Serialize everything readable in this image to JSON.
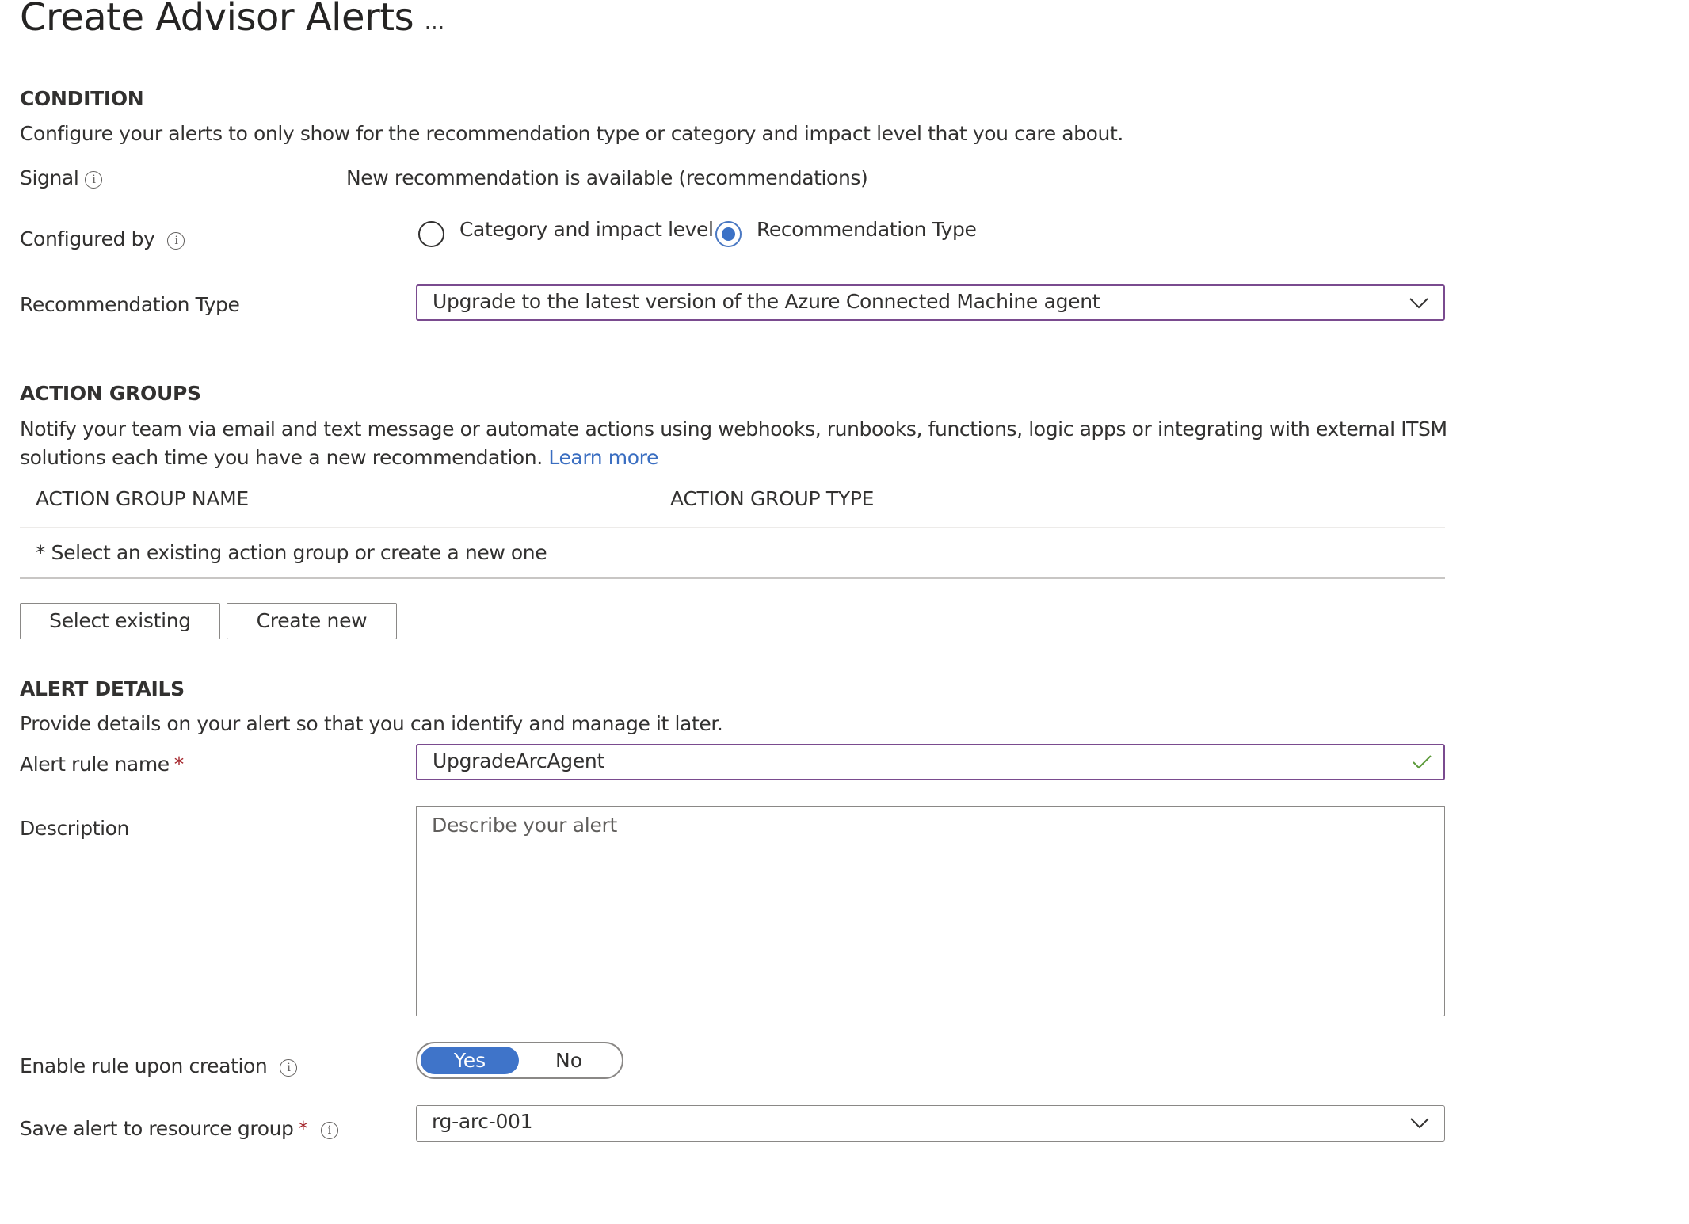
{
  "header": {
    "title": "Create Advisor Alerts",
    "more_label": "..."
  },
  "condition": {
    "heading": "CONDITION",
    "description": "Configure your alerts to only show for the recommendation type or category and impact level that you care about.",
    "signal_label": "Signal",
    "signal_value": "New recommendation is available (recommendations)",
    "configured_by_label": "Configured by",
    "configured_by_options": [
      {
        "label": "Category and impact level",
        "selected": false
      },
      {
        "label": "Recommendation Type",
        "selected": true
      }
    ],
    "recommendation_type_label": "Recommendation Type",
    "recommendation_type_value": "Upgrade to the latest version of the Azure Connected Machine agent"
  },
  "action_groups": {
    "heading": "ACTION GROUPS",
    "description_line1": "Notify your team via email and text message or automate actions using webhooks, runbooks, functions, logic apps or integrating with external ITSM",
    "description_line2": "solutions each time you have a new recommendation.",
    "learn_more": "Learn more",
    "columns": [
      "ACTION GROUP NAME",
      "ACTION GROUP TYPE"
    ],
    "empty_message": "* Select an existing action group or create a new one",
    "select_existing_label": "Select existing",
    "create_new_label": "Create new"
  },
  "alert_details": {
    "heading": "ALERT DETAILS",
    "description": "Provide details on your alert so that you can identify and manage it later.",
    "rule_name_label": "Alert rule name",
    "rule_name_value": "UpgradeArcAgent",
    "description_label": "Description",
    "description_placeholder": "Describe your alert",
    "enable_label": "Enable rule upon creation",
    "enable_options": [
      "Yes",
      "No"
    ],
    "enable_selected": "Yes",
    "resource_group_label": "Save alert to resource group",
    "resource_group_value": "rg-arc-001",
    "required_mark": "*"
  },
  "colors": {
    "focus_border": "#7a4b8f",
    "accent_blue": "#3f74c9",
    "link": "#3a6ec1",
    "valid_check": "#5c9a3a",
    "required": "#a4262c"
  },
  "icons": {
    "info": "i"
  }
}
